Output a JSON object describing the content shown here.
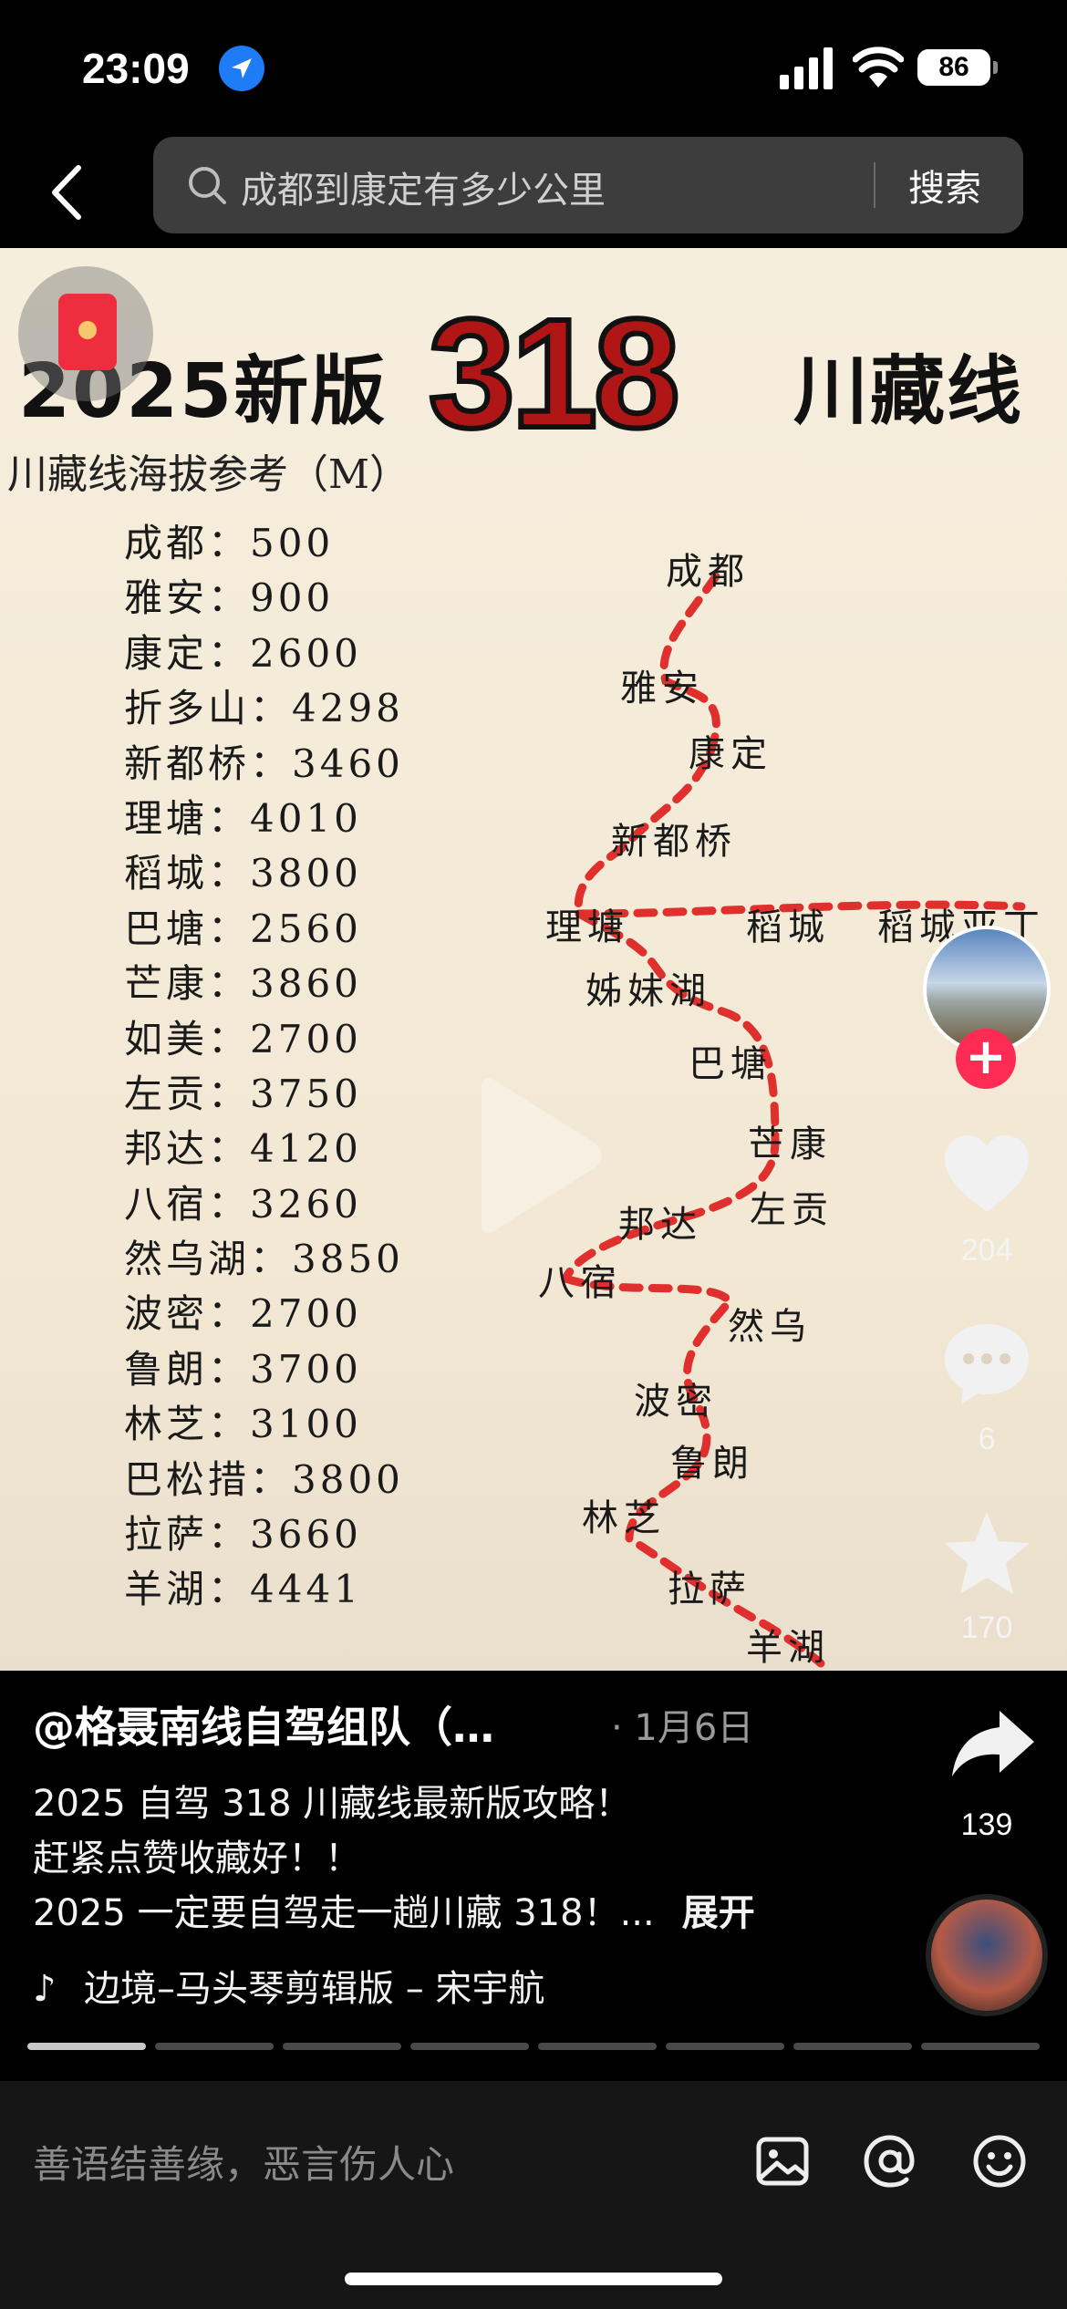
{
  "status_bar": {
    "time": "23:09",
    "battery": "86"
  },
  "search": {
    "query": "成都到康定有多少公里",
    "button": "搜索"
  },
  "video": {
    "title_left": "2025新版",
    "title_number": "318",
    "title_right": "川藏线",
    "altitude_heading": "川藏线海拔参考（M）",
    "altitudes": [
      "成都：500",
      "雅安：900",
      "康定：2600",
      "折多山：4298",
      "新都桥：3460",
      "理塘：4010",
      "稻城：3800",
      "巴塘：2560",
      "芒康：3860",
      "如美：2700",
      "左贡：3750",
      "邦达：4120",
      "八宿：3260",
      "然乌湖：3850",
      "波密：2700",
      "鲁朗：3700",
      "林芝：3100",
      "巴松措：3800",
      "拉萨：3660",
      "羊湖：4441"
    ],
    "route_places": {
      "chengdu": "成都",
      "yaan": "雅安",
      "kangding": "康定",
      "xinduqiao": "新都桥",
      "litang": "理塘",
      "daocheng": "稻城",
      "daocheng_yading": "稻城亚丁",
      "zimeihu": "姊妹湖",
      "batang": "巴塘",
      "mangkang": "芒康",
      "zuogong": "左贡",
      "bangda": "邦达",
      "basu": "八宿",
      "ranwu": "然乌",
      "bomi": "波密",
      "lulang": "鲁朗",
      "linzhi": "林芝",
      "lasa": "拉萨",
      "yanghu": "羊湖"
    }
  },
  "rail": {
    "likes": "204",
    "comments": "6",
    "favorites": "170",
    "shares": "139"
  },
  "post": {
    "author": "@格聂南线自驾组队（…",
    "date": "· 1月6日",
    "desc_line1": "2025 自驾 318 川藏线最新版攻略！",
    "desc_line2": "赶紧点赞收藏好！！",
    "desc_line3": "2025 一定要自驾走一趟川藏 318！...",
    "expand": "展开",
    "music": "边境–马头琴剪辑版 – 宋宇航"
  },
  "comment_bar": {
    "placeholder": "善语结善缘，恶言伤人心"
  },
  "colors": {
    "accent": "#fe2c55",
    "route_red": "#e0302e",
    "title_red": "#b11616"
  }
}
